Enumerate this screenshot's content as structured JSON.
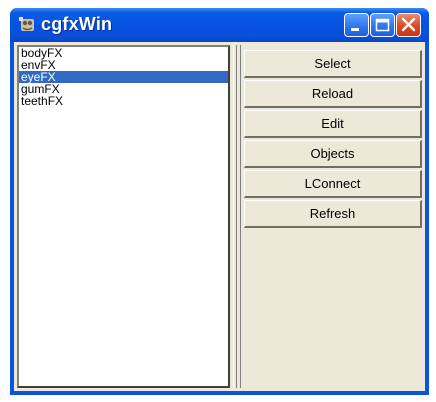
{
  "window": {
    "title": "cgfxWin",
    "title_color": "#ffffff",
    "titlebar_color": "#0a55df",
    "client_color": "#ece9d8"
  },
  "titlebar_buttons": [
    {
      "name": "minimize",
      "icon": "minimize-icon"
    },
    {
      "name": "maximize",
      "icon": "maximize-icon"
    },
    {
      "name": "close",
      "icon": "close-icon"
    }
  ],
  "list": {
    "items": [
      {
        "label": "bodyFX"
      },
      {
        "label": "envFX"
      },
      {
        "label": "eyeFX"
      },
      {
        "label": "gumFX"
      },
      {
        "label": "teethFX"
      }
    ],
    "selected": "eyeFX",
    "selection_color": "#316ac5"
  },
  "buttons": [
    {
      "label": "Select"
    },
    {
      "label": "Reload"
    },
    {
      "label": "Edit"
    },
    {
      "label": "Objects"
    },
    {
      "label": "LConnect"
    },
    {
      "label": "Refresh"
    }
  ]
}
